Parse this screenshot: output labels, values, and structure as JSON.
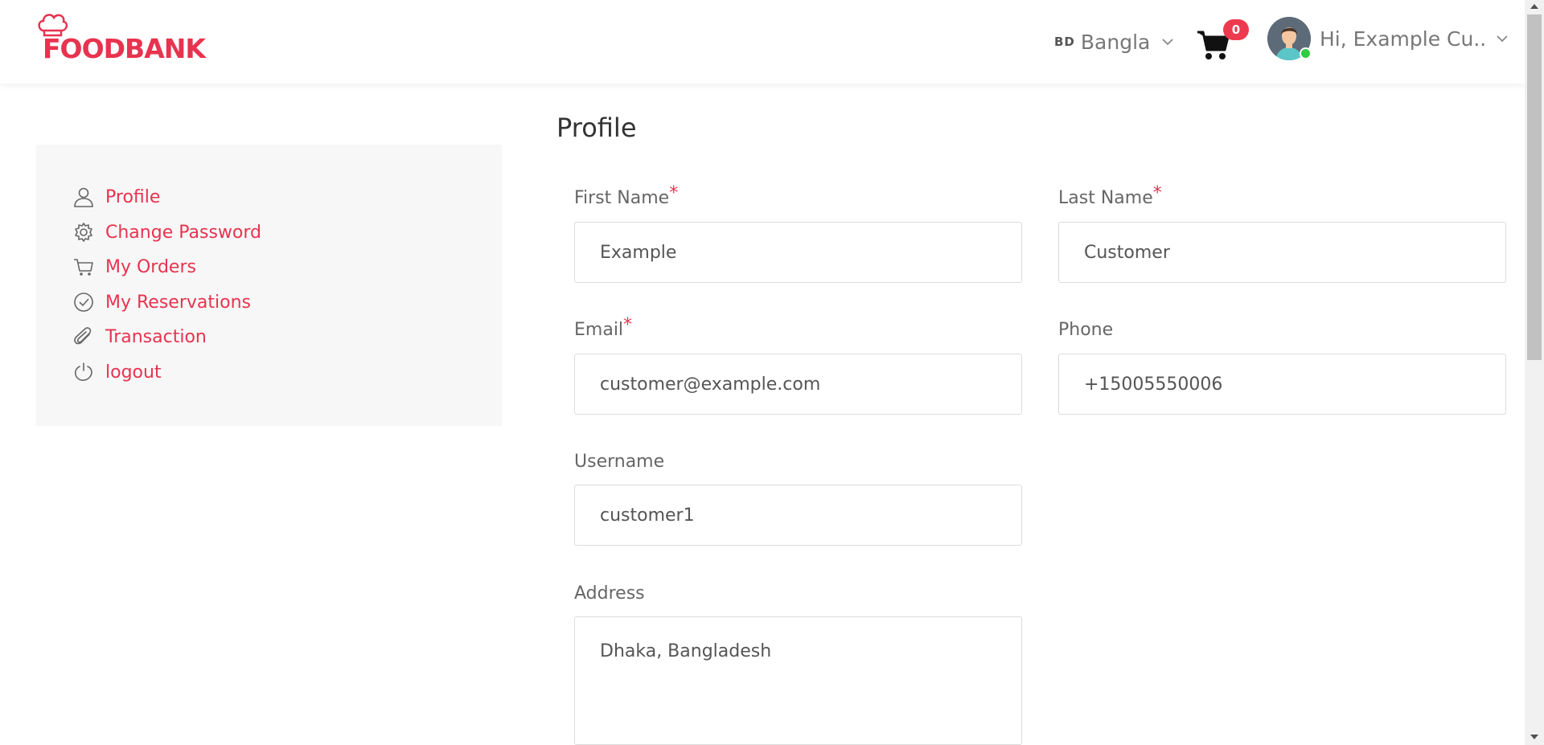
{
  "header": {
    "logo_text": "FOODBANK",
    "language": {
      "flag": "BD",
      "label": "Bangla"
    },
    "cart": {
      "count": "0"
    },
    "user": {
      "greeting": "Hi, Example Cu.."
    }
  },
  "sidebar": {
    "items": [
      {
        "label": "Profile",
        "icon": "user-icon"
      },
      {
        "label": "Change Password",
        "icon": "gear-icon"
      },
      {
        "label": "My Orders",
        "icon": "cart-icon"
      },
      {
        "label": "My Reservations",
        "icon": "check-circle-icon"
      },
      {
        "label": "Transaction",
        "icon": "paperclip-icon"
      },
      {
        "label": "logout",
        "icon": "power-icon"
      }
    ]
  },
  "main": {
    "title": "Profile",
    "fields": {
      "first_name": {
        "label": "First Name",
        "required": "*",
        "value": "Example"
      },
      "last_name": {
        "label": "Last Name",
        "required": "*",
        "value": "Customer"
      },
      "email": {
        "label": "Email",
        "required": "*",
        "value": "customer@example.com"
      },
      "phone": {
        "label": "Phone",
        "value": "+15005550006"
      },
      "username": {
        "label": "Username",
        "value": "customer1"
      },
      "address": {
        "label": "Address",
        "value": "Dhaka, Bangladesh"
      }
    }
  },
  "colors": {
    "accent": "#e8334f",
    "sidebar_bg": "#f7f7f7",
    "online": "#2ecc40"
  }
}
